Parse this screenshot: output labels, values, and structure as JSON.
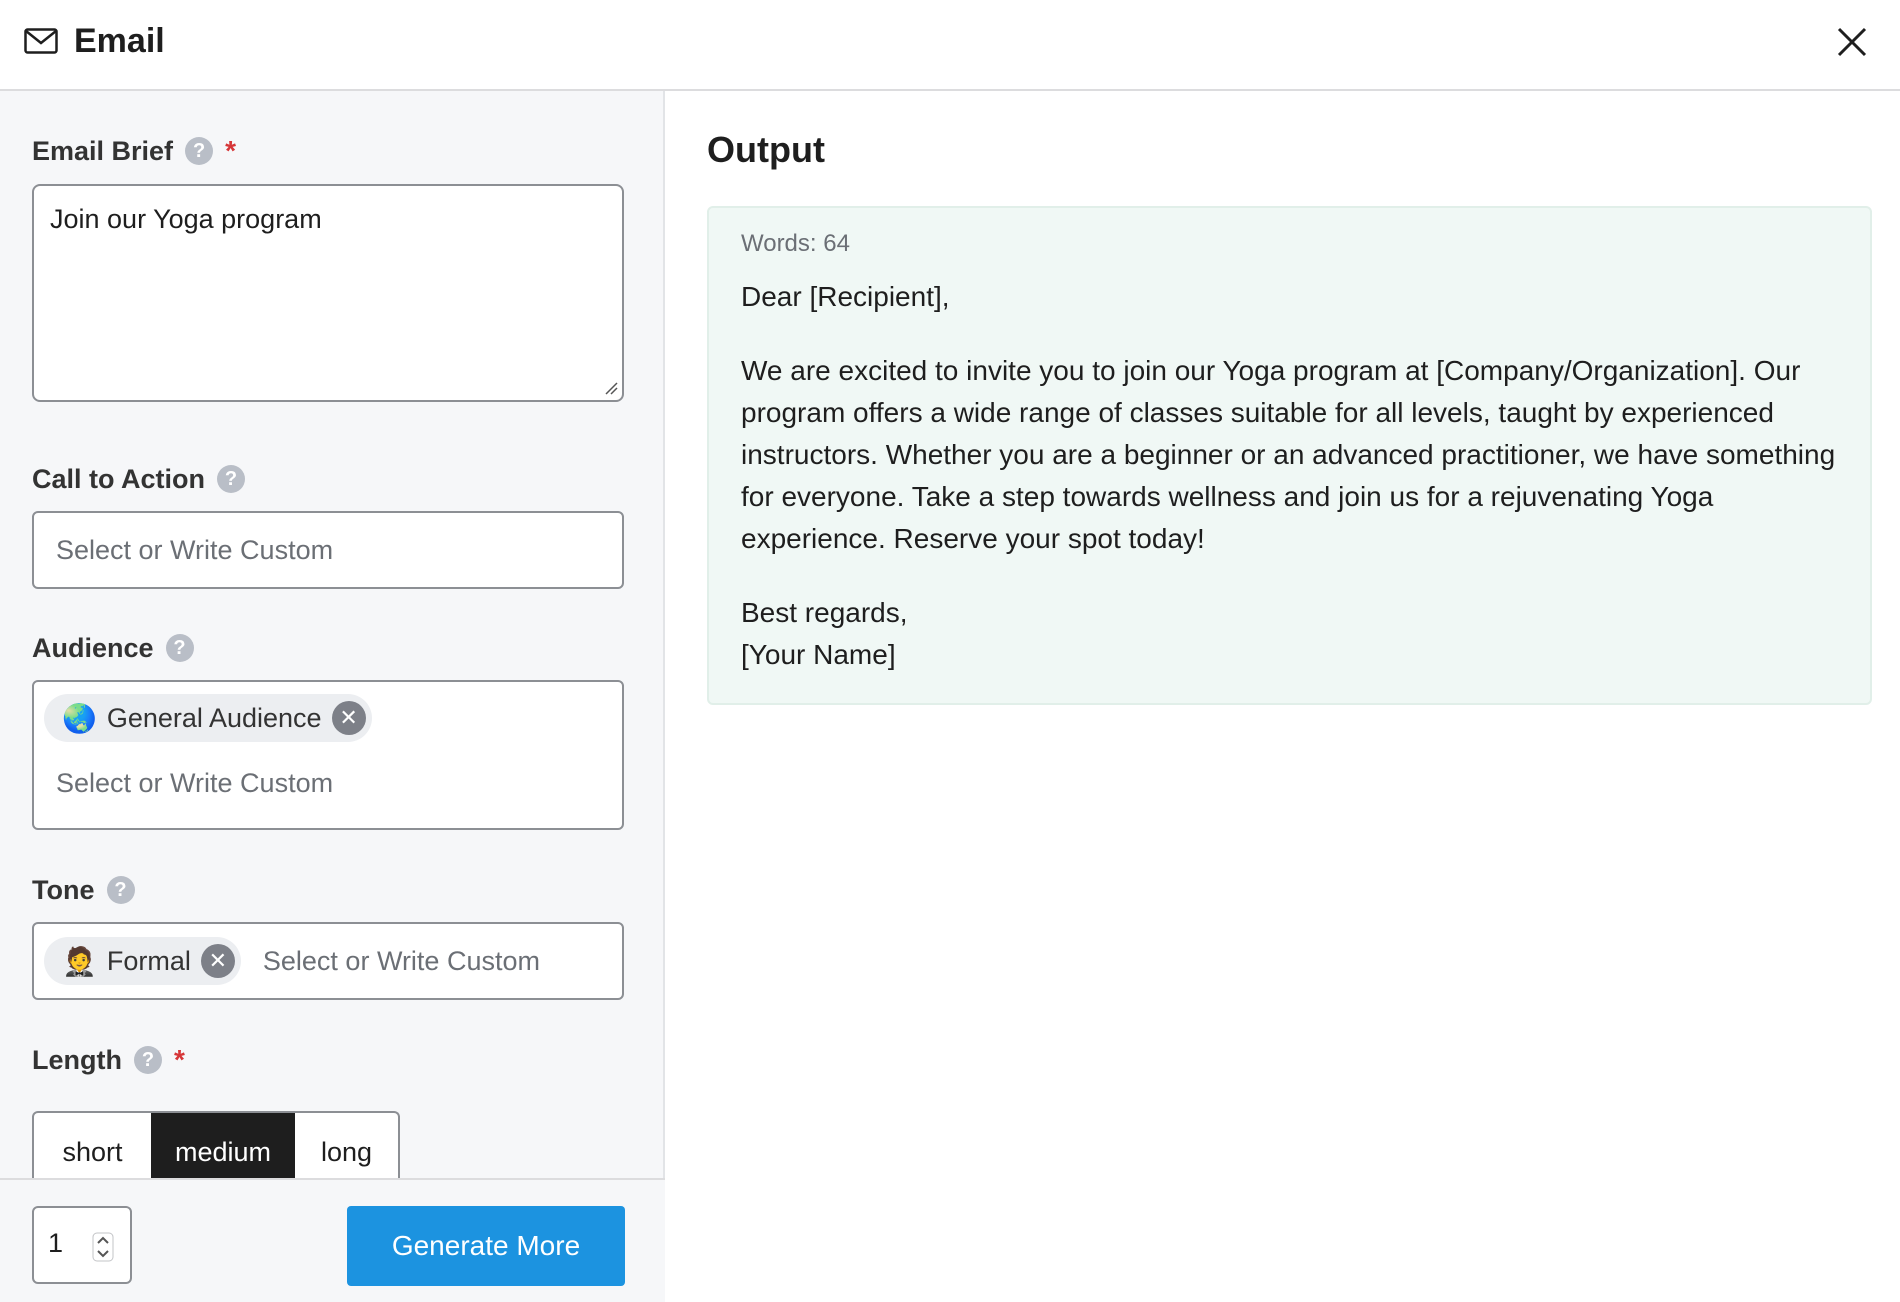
{
  "header": {
    "title": "Email",
    "icon": "mail-icon"
  },
  "form": {
    "email_brief": {
      "label": "Email Brief",
      "required": "*",
      "value": "Join our Yoga program"
    },
    "call_to_action": {
      "label": "Call to Action",
      "placeholder": "Select or Write Custom"
    },
    "audience": {
      "label": "Audience",
      "chip": {
        "emoji": "🌏",
        "label": "General Audience"
      },
      "placeholder": "Select or Write Custom"
    },
    "tone": {
      "label": "Tone",
      "chip": {
        "emoji": "🤵",
        "label": "Formal"
      },
      "placeholder": "Select or Write Custom"
    },
    "length": {
      "label": "Length",
      "required": "*",
      "options": [
        "short",
        "medium",
        "long"
      ],
      "selected": "medium"
    }
  },
  "footer": {
    "quantity": "1",
    "generate_label": "Generate More"
  },
  "output": {
    "title": "Output",
    "word_count": "Words: 64",
    "greeting": "Dear [Recipient],",
    "body": "We are excited to invite you to join our Yoga program at [Company/Organization]. Our program offers a wide range of classes suitable for all levels, taught by experienced instructors. Whether you are a beginner or an advanced practitioner, we have something for everyone. Take a step towards wellness and join us for a rejuvenating Yoga experience. Reserve your spot today!",
    "closing": "Best regards,",
    "signature": "[Your Name]"
  },
  "colors": {
    "primary_button": "#1c93e0",
    "required": "#d63638",
    "output_background": "#f0f8f5",
    "selected_segment": "#1e1e1e"
  }
}
